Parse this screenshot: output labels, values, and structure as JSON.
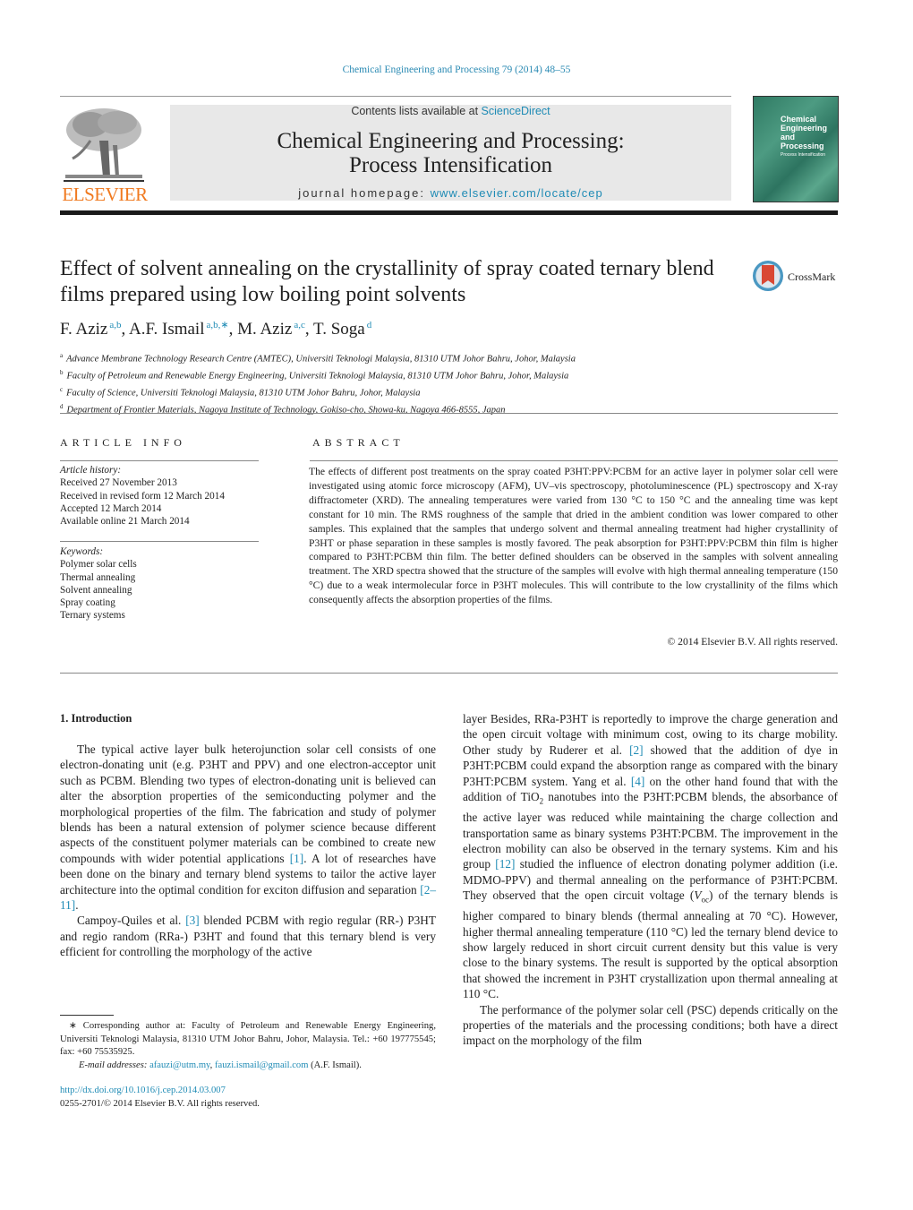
{
  "header": {
    "journal_ref": "Chemical Engineering and Processing 79 (2014) 48–55",
    "publisher_wordmark": "ELSEVIER",
    "contents_prefix": "Contents lists available at ",
    "contents_link": "ScienceDirect",
    "journal_title_line1": "Chemical Engineering and Processing:",
    "journal_title_line2": "Process Intensification",
    "homepage_prefix": "journal homepage: ",
    "homepage_link": "www.elsevier.com/locate/cep",
    "cover_title": [
      "Chemical",
      "Engineering",
      "and",
      "Processing"
    ],
    "cover_subtitle": "Process Intensification",
    "crossmark_label": "CrossMark",
    "colors": {
      "link": "#1f8bb5",
      "elsevier_orange": "#f07a20",
      "cover_green": "#2f7a63"
    }
  },
  "article": {
    "title": "Effect of solvent annealing on the crystallinity of spray coated ternary blend films prepared using low boiling point solvents",
    "authors": [
      {
        "name": "F. Aziz",
        "sup": "a,b",
        "sep": ", "
      },
      {
        "name": "A.F. Ismail",
        "sup": "a,b,∗",
        "sep": ", "
      },
      {
        "name": "M. Aziz",
        "sup": "a,c",
        "sep": ", "
      },
      {
        "name": "T. Soga",
        "sup": "d",
        "sep": ""
      }
    ],
    "affiliations": [
      {
        "key": "a",
        "text": "Advance Membrane Technology Research Centre (AMTEC), Universiti Teknologi Malaysia, 81310 UTM Johor Bahru, Johor, Malaysia"
      },
      {
        "key": "b",
        "text": "Faculty of Petroleum and Renewable Energy Engineering, Universiti Teknologi Malaysia, 81310 UTM Johor Bahru, Johor, Malaysia"
      },
      {
        "key": "c",
        "text": "Faculty of Science, Universiti Teknologi Malaysia, 81310 UTM Johor Bahru, Johor, Malaysia"
      },
      {
        "key": "d",
        "text": "Department of Frontier Materials, Nagoya Institute of Technology, Gokiso-cho, Showa-ku, Nagoya 466-8555, Japan"
      }
    ]
  },
  "article_info": {
    "label": "ARTICLE INFO",
    "history_label": "Article history:",
    "history": [
      "Received 27 November 2013",
      "Received in revised form 12 March 2014",
      "Accepted 12 March 2014",
      "Available online 21 March 2014"
    ],
    "keywords_label": "Keywords:",
    "keywords": [
      "Polymer solar cells",
      "Thermal annealing",
      "Solvent annealing",
      "Spray coating",
      "Ternary systems"
    ]
  },
  "abstract": {
    "label": "ABSTRACT",
    "text": "The effects of different post treatments on the spray coated P3HT:PPV:PCBM for an active layer in polymer solar cell were investigated using atomic force microscopy (AFM), UV–vis spectroscopy, photoluminescence (PL) spectroscopy and X-ray diffractometer (XRD). The annealing temperatures were varied from 130 °C to 150 °C and the annealing time was kept constant for 10 min. The RMS roughness of the sample that dried in the ambient condition was lower compared to other samples. This explained that the samples that undergo solvent and thermal annealing treatment had higher crystallinity of P3HT or phase separation in these samples is mostly favored. The peak absorption for P3HT:PPV:PCBM thin film is higher compared to P3HT:PCBM thin film. The better defined shoulders can be observed in the samples with solvent annealing treatment. The XRD spectra showed that the structure of the samples will evolve with high thermal annealing temperature (150 °C) due to a weak intermolecular force in P3HT molecules. This will contribute to the low crystallinity of the films which consequently affects the absorption properties of the films.",
    "copyright": "© 2014 Elsevier B.V. All rights reserved."
  },
  "body": {
    "section_heading": "1.  Introduction",
    "left": {
      "p1_a": "The typical active layer bulk heterojunction solar cell consists of one electron-donating unit (e.g. P3HT and PPV) and one electron-acceptor unit such as PCBM. Blending two types of electron-donating unit is believed can alter the absorption properties of the semiconducting polymer and the morphological properties of the film. The fabrication and study of polymer blends has been a natural extension of polymer science because different aspects of the constituent polymer materials can be combined to create new compounds with wider potential applications ",
      "ref1": "[1]",
      "p1_b": ". A lot of researches have been done on the binary and ternary blend systems to tailor the active layer architecture into the optimal condition for exciton diffusion and separation ",
      "ref2": "[2–11]",
      "p1_c": ".",
      "p2_a": "Campoy-Quiles et al. ",
      "ref3": "[3]",
      "p2_b": " blended PCBM with regio regular (RR-) P3HT and regio random (RRa-) P3HT and found that this ternary blend is very efficient for controlling the morphology of the active"
    },
    "right": {
      "p1_a": "layer Besides, RRa-P3HT is reportedly to improve the charge generation and the open circuit voltage with minimum cost, owing to its charge mobility. Other study by Ruderer et al. ",
      "ref2": "[2]",
      "p1_b": " showed that the addition of dye in P3HT:PCBM could expand the absorption range as compared with the binary P3HT:PCBM system. Yang et al. ",
      "ref4": "[4]",
      "p1_c": " on the other hand found that with the addition of TiO",
      "p1_sub": "2",
      "p1_d": " nanotubes into the P3HT:PCBM blends, the absorbance of the active layer was reduced while maintaining the charge collection and transportation same as binary systems P3HT:PCBM. The improvement in the electron mobility can also be observed in the ternary systems. Kim and his group ",
      "ref12": "[12]",
      "p1_e": " studied the influence of electron donating polymer addition (i.e. MDMO-PPV) and thermal annealing on the performance of P3HT:PCBM. They observed that the open circuit voltage (",
      "voc": "V",
      "voc_sub": "oc",
      "p1_f": ") of the ternary blends is higher compared to binary blends (thermal annealing at 70 °C). However, higher thermal annealing temperature (110 °C) led the ternary blend device to show largely reduced in short circuit current density but this value is very close to the binary systems. The result is supported by the optical absorption that showed the increment in P3HT crystallization upon thermal annealing at 110 °C.",
      "p2": "The performance of the polymer solar cell (PSC) depends critically on the properties of the materials and the processing conditions; both have a direct impact on the morphology of the film"
    }
  },
  "footnote": {
    "corresponding": "∗  Corresponding author at: Faculty of Petroleum and Renewable Energy Engineering, Universiti Teknologi Malaysia, 81310 UTM Johor Bahru, Johor, Malaysia. Tel.: +60 197775545; fax: +60 75535925.",
    "email_label": "E-mail addresses: ",
    "email1": "afauzi@utm.my",
    "email_sep": ", ",
    "email2": "fauzi.ismail@gmail.com",
    "email_suffix": " (A.F. Ismail).",
    "doi": "http://dx.doi.org/10.1016/j.cep.2014.03.007",
    "issn_rights": "0255-2701/© 2014 Elsevier B.V. All rights reserved."
  }
}
